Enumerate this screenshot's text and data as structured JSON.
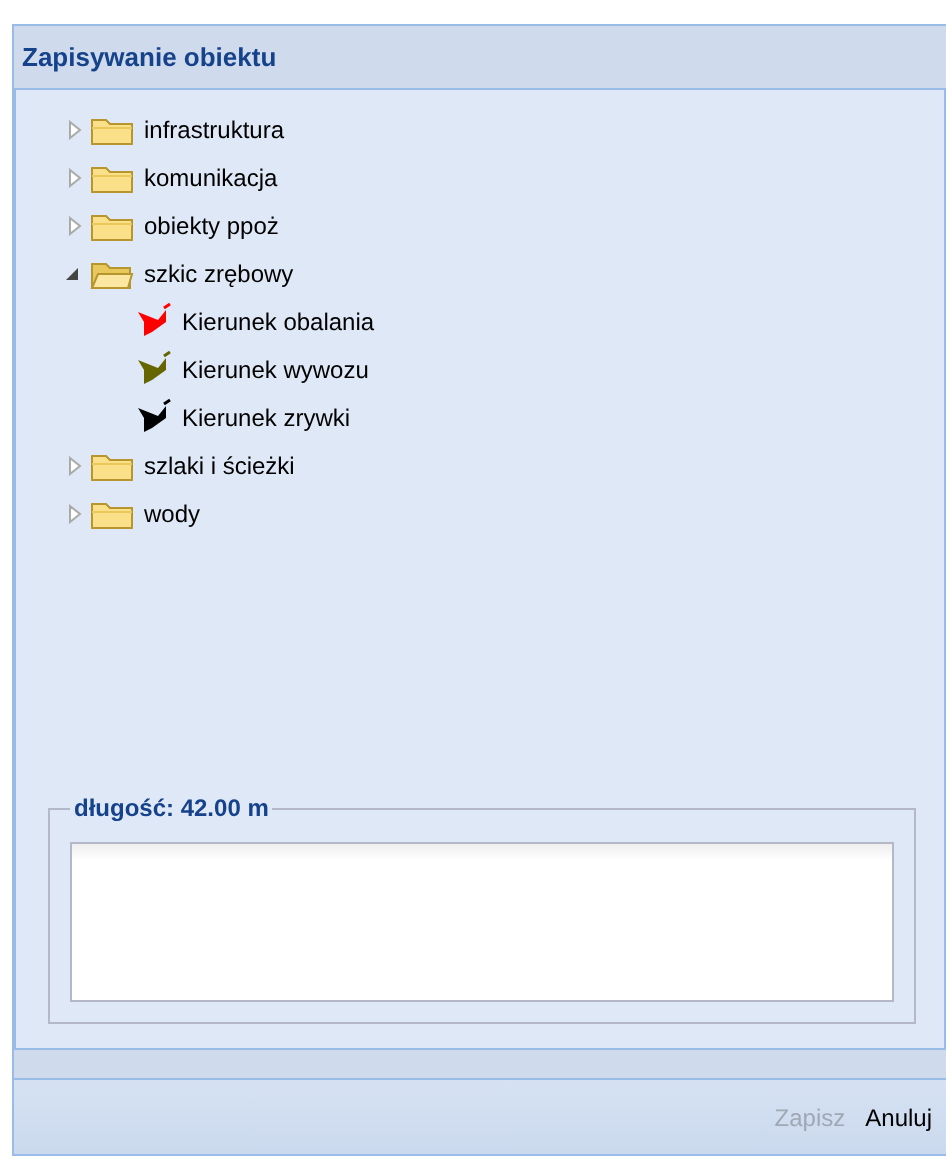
{
  "window": {
    "title": "Zapisywanie obiektu"
  },
  "tree": [
    {
      "label": "infrastruktura",
      "expanded": false
    },
    {
      "label": "komunikacja",
      "expanded": false
    },
    {
      "label": "obiekty ppoż",
      "expanded": false
    },
    {
      "label": "szkic zrębowy",
      "expanded": true,
      "children": [
        {
          "label": "Kierunek obalania",
          "color": "#ff0000"
        },
        {
          "label": "Kierunek wywozu",
          "color": "#666600"
        },
        {
          "label": "Kierunek zrywki",
          "color": "#000000"
        }
      ]
    },
    {
      "label": "szlaki i ścieżki",
      "expanded": false
    },
    {
      "label": "wody",
      "expanded": false
    }
  ],
  "fieldset": {
    "legend": "długość: 42.00 m"
  },
  "buttons": [
    {
      "label": "Zapisz",
      "disabled": true
    },
    {
      "label": "Anuluj",
      "disabled": false
    }
  ]
}
